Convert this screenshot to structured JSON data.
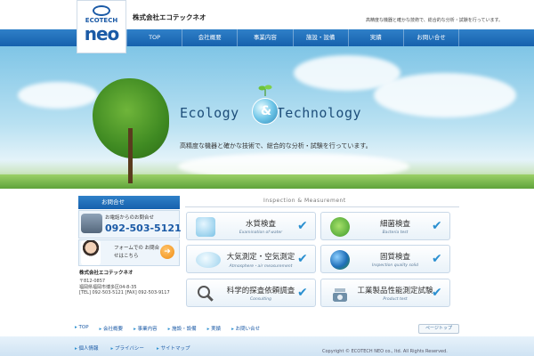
{
  "header": {
    "logo_top": "ECOTECH",
    "logo_bottom": "neo",
    "company_name": "株式会社エコテックネオ",
    "tagline": "高精度な機器と確かな技術で、総合的な分析・試験を行っています。"
  },
  "nav": {
    "items": [
      "TOP",
      "会社概要",
      "事業内容",
      "施設・設備",
      "実績",
      "お問い合せ"
    ]
  },
  "hero": {
    "title": "Ecology & Technology",
    "title_left": "Ecology",
    "title_amp": "&",
    "title_right": "Technology",
    "copy": "高精度な機器と確かな技術で、総合的な分析・試験を行っています。"
  },
  "sidebar": {
    "heading": "お問合せ",
    "phone_label": "お電話からのお問合せ",
    "phone_number": "092-503-5121",
    "form_label": "フォームでの お問合せはこちら",
    "company": "株式会社エコテックネオ",
    "postal": "〒812-0857",
    "address": "福岡県福岡市博多区04-8-35",
    "tel_fax": "[TEL] 092-503-5121 [FAX] 092-503-9117"
  },
  "services": {
    "heading": "Inspection & Measurement",
    "items": [
      {
        "title": "水質検査",
        "subtitle": "Examination of water",
        "icon": "water-icon"
      },
      {
        "title": "細菌検査",
        "subtitle": "Bacteria test",
        "icon": "bacteria-icon"
      },
      {
        "title": "大気測定・空気測定",
        "subtitle": "Atmosphere・air measurement",
        "icon": "air-icon"
      },
      {
        "title": "固質検査",
        "subtitle": "Inspection quality solid",
        "icon": "globe-icon"
      },
      {
        "title": "科学的探査依頼調査",
        "subtitle": "Consulting",
        "icon": "magnifier-icon"
      },
      {
        "title": "工業製品性能測定試験",
        "subtitle": "Product test",
        "icon": "scale-icon"
      }
    ]
  },
  "footer": {
    "links_1": [
      "TOP",
      "会社概要",
      "事業内容",
      "施設・設備",
      "実績",
      "お問い合せ"
    ],
    "pagetop": "ページトップ",
    "links_2": [
      "個人情報",
      "プライバシー",
      "サイトマップ"
    ],
    "copyright": "Copyright © ECOTECH NEO co., ltd. All Rights Reserved."
  },
  "colors": {
    "brand_blue": "#1b5aa6",
    "nav_blue": "#1661ad",
    "accent_orange": "#f08c12",
    "check_blue": "#2a8fd0"
  }
}
